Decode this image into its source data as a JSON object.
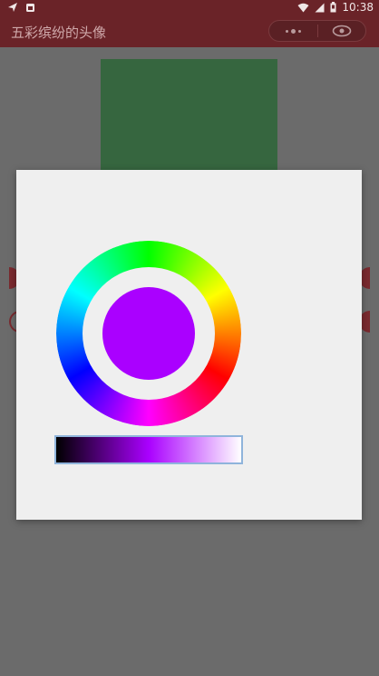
{
  "status_bar": {
    "time": "10:38",
    "icons": [
      "send-icon",
      "notification-icon",
      "wifi-icon",
      "signal-icon",
      "battery-icon"
    ]
  },
  "app_bar": {
    "title": "五彩缤纷的头像",
    "capsule_icons": [
      "more-icon",
      "close-icon"
    ]
  },
  "background": {
    "avatar_color": "#36663f"
  },
  "color_picker": {
    "selected_color": "#aa00ff",
    "hue_stops": [
      "#ff0000",
      "#ffff00",
      "#00ff00",
      "#00ffff",
      "#0000ff",
      "#ff00ff",
      "#ff0000"
    ],
    "brightness_stops": [
      "#000000",
      "#aa00ff",
      "#ffffff"
    ]
  },
  "colors": {
    "app_bar_bg": "#6a2328",
    "dialog_bg": "#efefef",
    "overlay_bg": "#6b6b6b",
    "brightness_border": "#8fb4db"
  }
}
